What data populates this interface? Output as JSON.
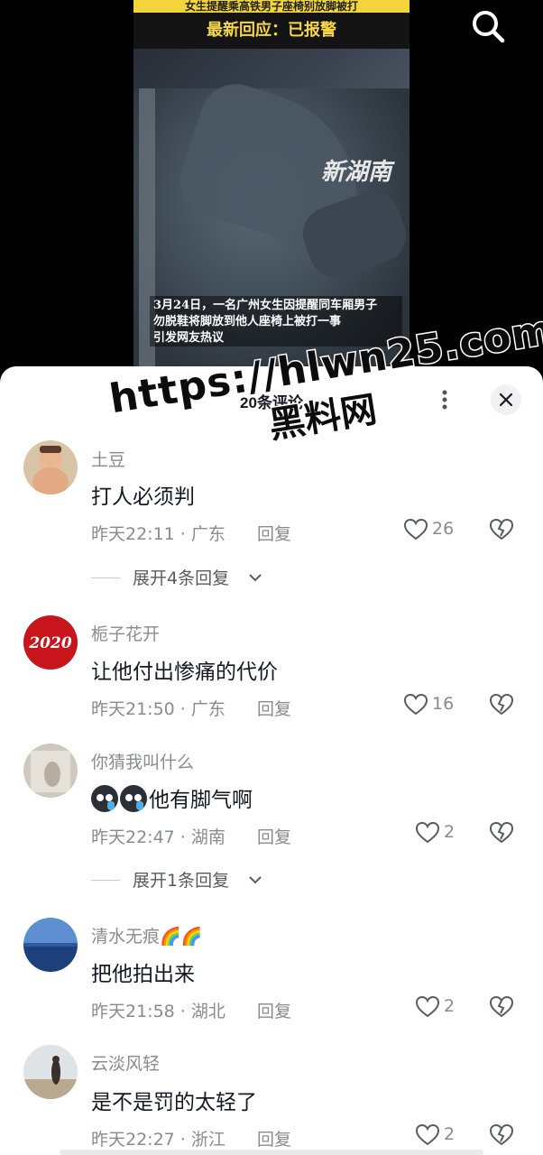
{
  "video": {
    "title_bar": "女生提醒乘高铁男子座椅别放脚被打",
    "subtitle": "最新回应：已报警",
    "logo_text": "新湖南",
    "caption": [
      "3月24日，一名广州女生因提醒同车厢男子",
      "勿脱鞋将脚放到他人座椅上被打一事",
      "引发网友热议"
    ]
  },
  "top_bar": {
    "search_icon": "search-icon"
  },
  "sheet": {
    "title": "20条评论",
    "more_label": "⋮",
    "close_icon": "close-icon"
  },
  "overlay_watermark": {
    "line1": "https://hlwn25.com",
    "line2": "黑料网"
  },
  "comments": [
    {
      "user": "土豆",
      "text": "打人必须判",
      "meta": "昨天22:11 · 广东",
      "reply": "回复",
      "likes": "26",
      "expand": "展开4条回复"
    },
    {
      "user": "栀子花开",
      "text": "让他付出惨痛的代价",
      "meta": "昨天21:50 · 广东",
      "reply": "回复",
      "likes": "16"
    },
    {
      "user": "你猜我叫什么",
      "text": "他有脚气啊",
      "meta": "昨天22:47 · 湖南",
      "reply": "回复",
      "likes": "2",
      "expand": "展开1条回复"
    },
    {
      "user": "清水无痕🌈🌈",
      "text": "把他拍出来",
      "meta": "昨天21:58 · 湖北",
      "reply": "回复",
      "likes": "2"
    },
    {
      "user": "云淡风轻",
      "text": "是不是罚的太轻了",
      "meta": "昨天22:27 · 浙江",
      "reply": "回复",
      "likes": "2"
    }
  ],
  "avatar2_text": "2020",
  "colors": {
    "text": "#161823",
    "muted": "#8a8b91",
    "sheet_bg": "#ffffff",
    "video_yellow": "#f6d64a"
  }
}
